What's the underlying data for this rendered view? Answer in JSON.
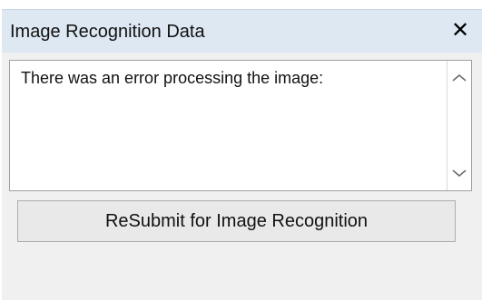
{
  "window": {
    "title": "Image Recognition Data",
    "close_icon": "close-icon"
  },
  "content": {
    "message": "There was an error processing the image:",
    "resubmit_label": "ReSubmit for Image Recognition"
  },
  "icons": {
    "scroll_up": "chevron-up-icon",
    "scroll_down": "chevron-down-icon"
  },
  "colors": {
    "titlebar_bg": "#dde8f3",
    "content_bg": "#f0f0f0",
    "button_bg": "#e9e9e9"
  }
}
